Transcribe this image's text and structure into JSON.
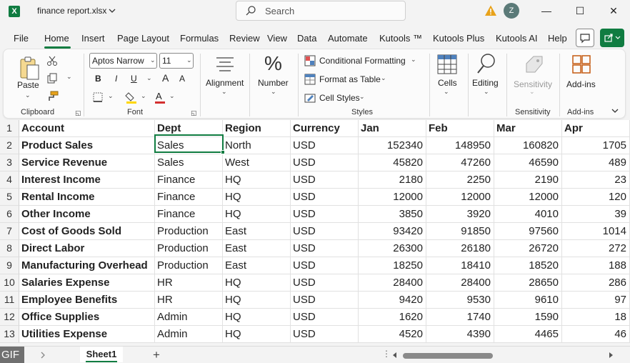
{
  "titlebar": {
    "file_name": "finance report.xlsx",
    "search_placeholder": "Search",
    "avatar_initial": "Z",
    "minimize": "—",
    "maximize": "☐",
    "close": "✕"
  },
  "menu": {
    "tabs": [
      "File",
      "Home",
      "Insert",
      "Page Layout",
      "Formulas",
      "Review",
      "View",
      "Data",
      "Automate",
      "Kutools ™",
      "Kutools Plus",
      "Kutools AI",
      "Help"
    ],
    "active": "Home"
  },
  "ribbon": {
    "clipboard": {
      "paste": "Paste",
      "label": "Clipboard"
    },
    "font": {
      "name": "Aptos Narrow",
      "size": "11",
      "bold": "B",
      "italic": "I",
      "underline": "U",
      "grow": "A",
      "shrink": "A",
      "label": "Font"
    },
    "alignment": {
      "label": "Alignment"
    },
    "number": {
      "symbol": "%",
      "label": "Number"
    },
    "styles": {
      "conditional": "Conditional Formatting",
      "table": "Format as Table",
      "cell_styles": "Cell Styles",
      "label": "Styles"
    },
    "cells": {
      "label": "Cells"
    },
    "editing": {
      "label": "Editing"
    },
    "sensitivity": {
      "button": "Sensitivity",
      "label": "Sensitivity"
    },
    "addins": {
      "button": "Add-ins",
      "label": "Add-ins"
    }
  },
  "sheet": {
    "columns": [
      "Account",
      "Dept",
      "Region",
      "Currency",
      "Jan",
      "Feb",
      "Mar",
      "Apr"
    ],
    "rows": [
      [
        "Product Sales",
        "Sales",
        "North",
        "USD",
        "152340",
        "148950",
        "160820",
        "1705"
      ],
      [
        "Service Revenue",
        "Sales",
        "West",
        "USD",
        "45820",
        "47260",
        "46590",
        "489"
      ],
      [
        "Interest Income",
        "Finance",
        "HQ",
        "USD",
        "2180",
        "2250",
        "2190",
        "23"
      ],
      [
        "Rental Income",
        "Finance",
        "HQ",
        "USD",
        "12000",
        "12000",
        "12000",
        "120"
      ],
      [
        "Other Income",
        "Finance",
        "HQ",
        "USD",
        "3850",
        "3920",
        "4010",
        "39"
      ],
      [
        "Cost of Goods Sold",
        "Production",
        "East",
        "USD",
        "93420",
        "91850",
        "97560",
        "1014"
      ],
      [
        "Direct Labor",
        "Production",
        "East",
        "USD",
        "26300",
        "26180",
        "26720",
        "272"
      ],
      [
        "Manufacturing Overhead",
        "Production",
        "East",
        "USD",
        "18250",
        "18410",
        "18520",
        "188"
      ],
      [
        "Salaries Expense",
        "HR",
        "HQ",
        "USD",
        "28400",
        "28400",
        "28650",
        "286"
      ],
      [
        "Employee Benefits",
        "HR",
        "HQ",
        "USD",
        "9420",
        "9530",
        "9610",
        "97"
      ],
      [
        "Office Supplies",
        "Admin",
        "HQ",
        "USD",
        "1620",
        "1740",
        "1590",
        "18"
      ],
      [
        "Utilities Expense",
        "Admin",
        "HQ",
        "USD",
        "4520",
        "4390",
        "4465",
        "46"
      ]
    ]
  },
  "bottom": {
    "badge": "GIF",
    "sheet_tab": "Sheet1",
    "add_sheet": "+"
  }
}
